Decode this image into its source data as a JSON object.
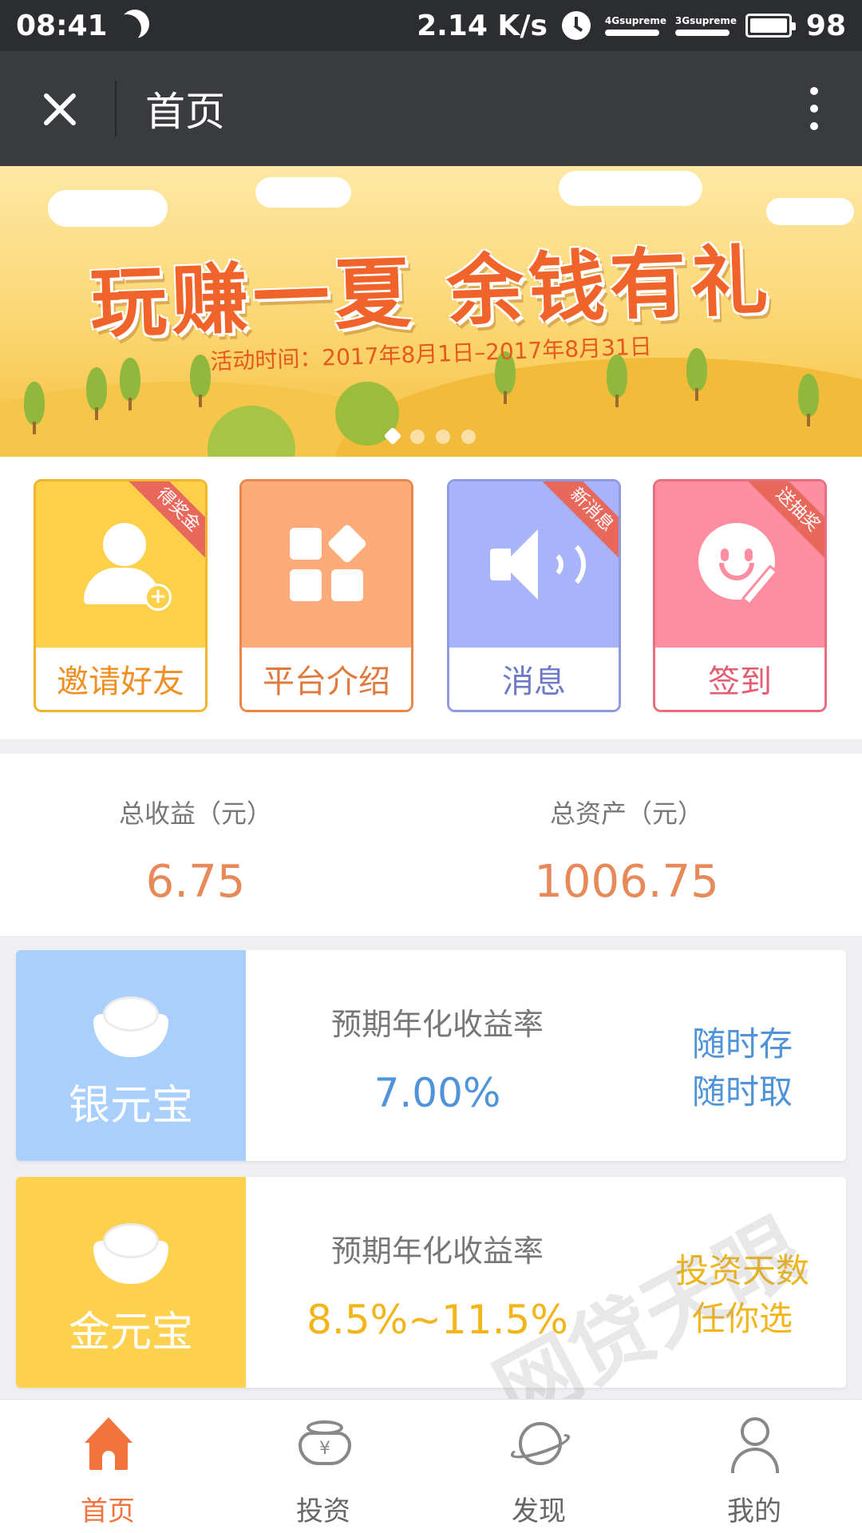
{
  "status_bar": {
    "time": "08:41",
    "speed": "2.14 K/s",
    "network_1": "4Gsupreme",
    "network_2": "3Gsupreme",
    "battery": "98"
  },
  "title_bar": {
    "title": "首页"
  },
  "banner": {
    "title": "玩赚一夏  余钱有礼",
    "subtitle": "活动时间：2017年8月1日–2017年8月31日",
    "slide_count": 4,
    "active_slide": 1
  },
  "features": [
    {
      "label": "邀请好友",
      "ribbon": "得奖金",
      "icon": "add-user-icon"
    },
    {
      "label": "平台介绍",
      "ribbon": "",
      "icon": "grid-icon"
    },
    {
      "label": "消息",
      "ribbon": "新消息",
      "icon": "speaker-icon"
    },
    {
      "label": "签到",
      "ribbon": "送抽奖",
      "icon": "smile-sign-icon"
    }
  ],
  "stats": {
    "total_income_label": "总收益（元）",
    "total_income_value": "6.75",
    "total_assets_label": "总资产（元）",
    "total_assets_value": "1006.75"
  },
  "products": [
    {
      "name": "银元宝",
      "rate_label": "预期年化收益率",
      "rate": "7.00%",
      "tag_line1": "随时存",
      "tag_line2": "随时取",
      "color": "#a9cffd"
    },
    {
      "name": "金元宝",
      "rate_label": "预期年化收益率",
      "rate": "8.5%~11.5%",
      "tag_line1": "投资天数",
      "tag_line2": "任你选",
      "color": "#fdd14d"
    }
  ],
  "watermark": "网贷天眼",
  "tabs": [
    {
      "label": "首页",
      "icon": "home-icon",
      "active": true
    },
    {
      "label": "投资",
      "icon": "invest-icon",
      "active": false
    },
    {
      "label": "发现",
      "icon": "discover-icon",
      "active": false
    },
    {
      "label": "我的",
      "icon": "user-icon",
      "active": false
    }
  ]
}
